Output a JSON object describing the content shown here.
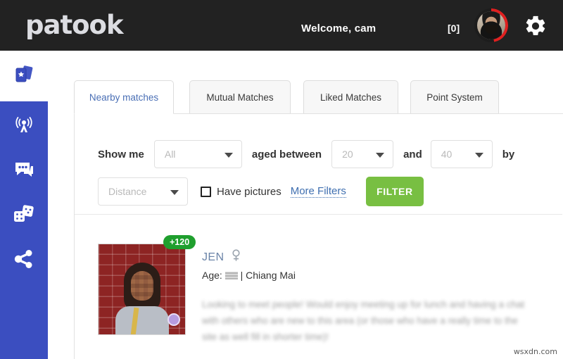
{
  "header": {
    "logo": "patook",
    "welcome": "Welcome, cam",
    "message_count": "[0]",
    "avatar_name": "user-avatar",
    "gear_label": "settings-gear"
  },
  "sidebar": {
    "items": [
      {
        "icon": "cards-icon",
        "label": "Cards",
        "active": true
      },
      {
        "icon": "broadcast-icon",
        "label": "Broadcast",
        "active": false
      },
      {
        "icon": "chat-icon",
        "label": "Chat",
        "active": false
      },
      {
        "icon": "dice-icon",
        "label": "Games",
        "active": false
      },
      {
        "icon": "share-icon",
        "label": "Share",
        "active": false
      }
    ]
  },
  "tabs": [
    {
      "label": "Nearby matches",
      "active": true
    },
    {
      "label": "Mutual Matches",
      "active": false
    },
    {
      "label": "Liked Matches",
      "active": false
    },
    {
      "label": "Point System",
      "active": false
    }
  ],
  "filters": {
    "show_me_label": "Show me",
    "gender_value": "All",
    "aged_between_label": "aged between",
    "age_min_value": "20",
    "and_label": "and",
    "age_max_value": "40",
    "by_label": "by",
    "sort_value": "Distance",
    "have_pictures_label": "Have pictures",
    "have_pictures_checked": false,
    "more_filters_label": "More Filters",
    "filter_button_label": "FILTER",
    "filter_button_color": "#78bf42"
  },
  "results": [
    {
      "points_badge": "+120",
      "points_badge_color": "#1f9f2e",
      "name": "JEN",
      "gender_symbol": "♀",
      "age_label": "Age:",
      "age_value": "",
      "separator": "|",
      "city": "Chiang Mai",
      "description": "Looking to meet people! Would enjoy meeting up for lunch and having a chat with others who are new to this area (or those who have a really time to the site as well fill in shorter time)!",
      "online_status": "online"
    }
  ],
  "watermark": "wsxdn.com"
}
